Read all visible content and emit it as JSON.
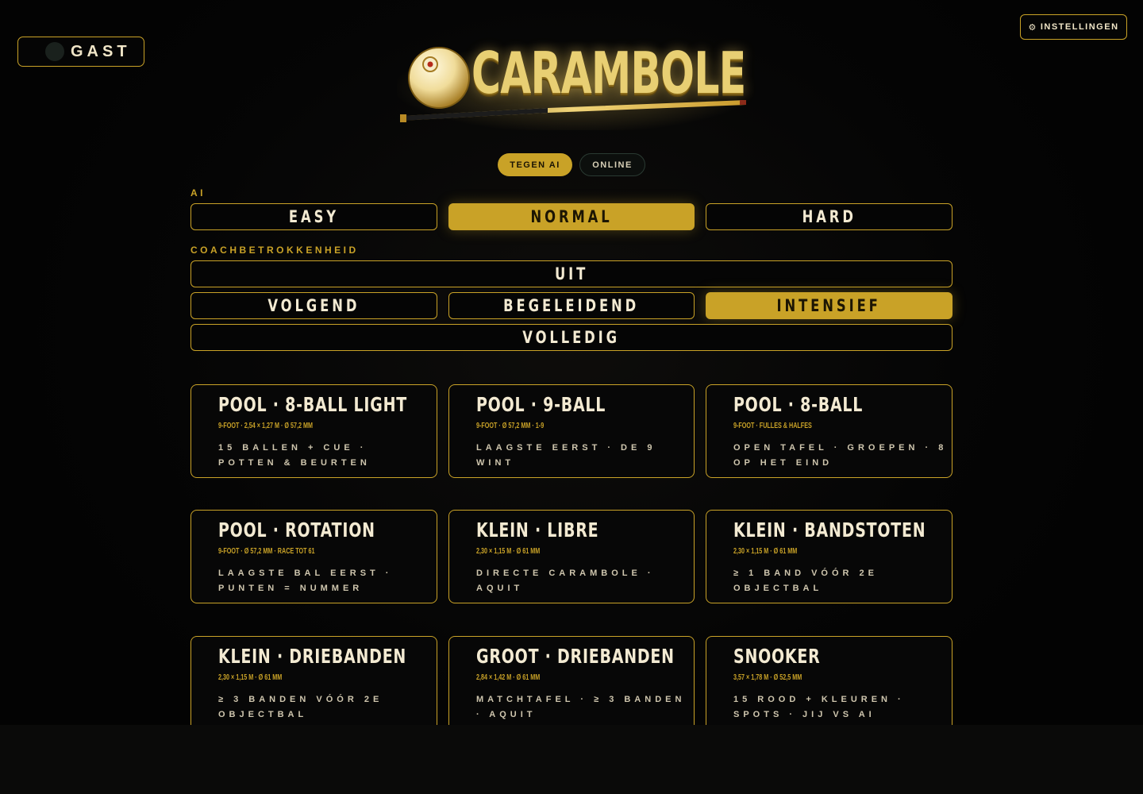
{
  "user": {
    "name": "GAST"
  },
  "settings": {
    "label": "INSTELLINGEN",
    "icon": "gear-icon"
  },
  "logo": {
    "text": "CARAMBOLE"
  },
  "modes": [
    {
      "label": "TEGEN AI",
      "active": true
    },
    {
      "label": "ONLINE",
      "active": false
    }
  ],
  "ai": {
    "label": "AI",
    "options": [
      {
        "label": "EASY",
        "active": false
      },
      {
        "label": "NORMAL",
        "active": true
      },
      {
        "label": "HARD",
        "active": false
      }
    ]
  },
  "coach": {
    "label": "COACHBETROKKENHEID",
    "options": [
      {
        "label": "UIT",
        "active": false
      },
      {
        "label": "VOLGEND",
        "active": false
      },
      {
        "label": "BEGELEIDEND",
        "active": false
      },
      {
        "label": "INTENSIEF",
        "active": true
      },
      {
        "label": "VOLLEDIG",
        "active": false
      }
    ]
  },
  "games": [
    {
      "title": "POOL · 8-BALL LIGHT",
      "spec": "9-FOOT · 2,54 × 1,27 M · Ø 57,2 MM",
      "desc": "15 BALLEN + CUE · POTTEN & BEURTEN"
    },
    {
      "title": "POOL · 9-BALL",
      "spec": "9-FOOT · Ø 57,2 MM · 1-9",
      "desc": "LAAGSTE EERST · DE 9 WINT"
    },
    {
      "title": "POOL · 8-BALL",
      "spec": "9-FOOT · FULLES & HALFES",
      "desc": "OPEN TAFEL · GROEPEN · 8 OP HET EIND"
    },
    {
      "title": "POOL · ROTATION",
      "spec": "9-FOOT · Ø 57,2 MM · RACE TOT 61",
      "desc": "LAAGSTE BAL EERST · PUNTEN = NUMMER"
    },
    {
      "title": "KLEIN · LIBRE",
      "spec": "2,30 × 1,15 M · Ø 61 MM",
      "desc": "DIRECTE CARAMBOLE · AQUIT"
    },
    {
      "title": "KLEIN · BANDSTOTEN",
      "spec": "2,30 × 1,15 M · Ø 61 MM",
      "desc": "≥ 1 BAND VÓÓR 2E OBJECTBAL"
    },
    {
      "title": "KLEIN · DRIEBANDEN",
      "spec": "2,30 × 1,15 M · Ø 61 MM",
      "desc": "≥ 3 BANDEN VÓÓR 2E OBJECTBAL"
    },
    {
      "title": "GROOT · DRIEBANDEN",
      "spec": "2,84 × 1,42 M · Ø 61 MM",
      "desc": "MATCHTAFEL · ≥ 3 BANDEN · AQUIT"
    },
    {
      "title": "SNOOKER",
      "spec": "3,57 × 1,78 M · Ø 52,5 MM",
      "desc": "15 ROOD + KLEUREN · SPOTS · JIJ VS AI"
    }
  ],
  "colors": {
    "accent": "#c9a227",
    "background": "#050505",
    "text": "#f3ead2"
  }
}
